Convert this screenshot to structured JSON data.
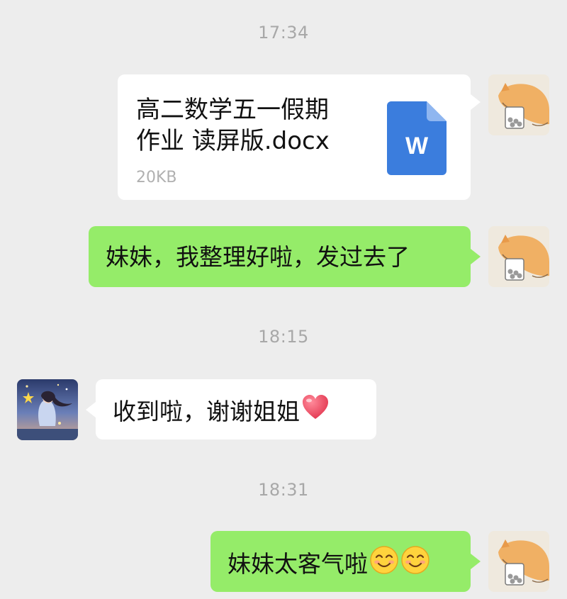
{
  "colors": {
    "background": "#ededed",
    "my_bubble": "#95ec69",
    "other_bubble": "#ffffff",
    "timestamp": "#a8a8a8",
    "word_icon": "#3b7ddd"
  },
  "chat": {
    "timestamps": [
      "17:34",
      "18:15",
      "18:31"
    ],
    "messages": [
      {
        "sender": "me",
        "type": "file",
        "file_name": "高二数学五一假期作业 读屏版.docx",
        "file_name_line1": "高二数学五一假期",
        "file_name_line2": "作业 读屏版.docx",
        "file_size": "20KB",
        "file_icon": "word-doc-icon",
        "file_icon_letter": "W"
      },
      {
        "sender": "me",
        "type": "text",
        "text": "妹妹，我整理好啦，发过去了"
      },
      {
        "sender": "other",
        "type": "text",
        "text": "收到啦，谢谢姐姐",
        "emoji": "red-heart-icon"
      },
      {
        "sender": "me",
        "type": "text",
        "text": "妹妹太客气啦",
        "emoji": "smiling-face-icon",
        "emoji_count": 2
      }
    ],
    "my_avatar": "shiba-dog-drinking-avatar",
    "other_avatar": "anime-girl-starry-night-avatar"
  }
}
